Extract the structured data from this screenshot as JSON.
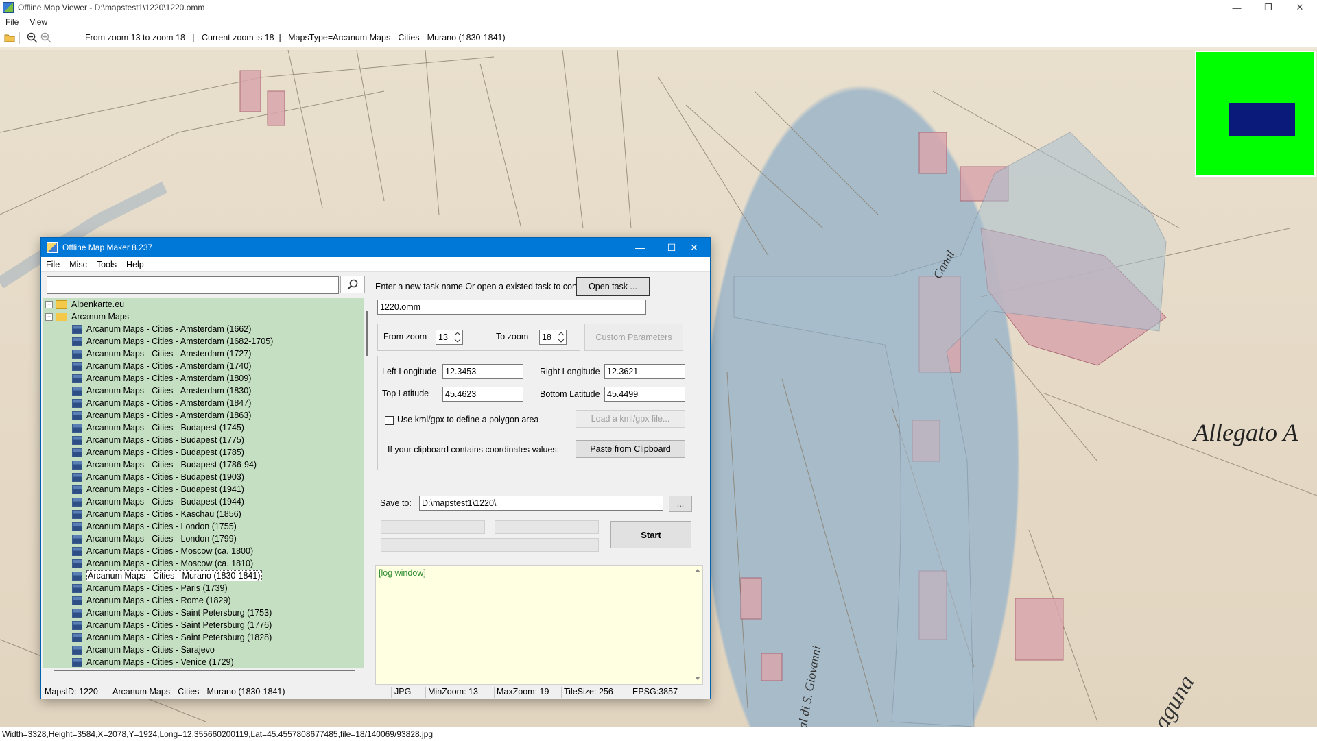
{
  "app": {
    "title": "Offline Map Viewer - D:\\mapstest1\\1220\\1220.omm",
    "menu": [
      "File",
      "View"
    ],
    "toolbar_info": "From zoom 13 to zoom 18   |   Current zoom is 18  |   MapsType=Arcanum Maps - Cities - Murano (1830-1841)",
    "icons": {
      "open": "folder-open-icon",
      "zoom_out": "zoom-out-icon",
      "zoom_in": "zoom-in-icon"
    },
    "statusbar": "Width=3328,Height=3584,X=2078,Y=1924,Long=12.355660200119,Lat=45.4557808677485,file=18/140069/93828.jpg"
  },
  "map": {
    "labels": [
      "Allegato A",
      "Canal",
      "Laguna",
      "Canal di S. Giovanni"
    ],
    "minimap_colors": {
      "background": "#00ff00",
      "viewport": "#0a1a7a"
    }
  },
  "dialog": {
    "title": "Offline Map Maker 8.237",
    "menu": [
      "File",
      "Misc",
      "Tools",
      "Help"
    ],
    "search_value": "",
    "tree": {
      "folders": [
        {
          "label": "Alpenkarte.eu",
          "expanded": false
        },
        {
          "label": "Arcanum Maps",
          "expanded": true
        }
      ],
      "items": [
        "Arcanum Maps - Cities - Amsterdam (1662)",
        "Arcanum Maps - Cities - Amsterdam (1682-1705)",
        "Arcanum Maps - Cities - Amsterdam (1727)",
        "Arcanum Maps - Cities - Amsterdam (1740)",
        "Arcanum Maps - Cities - Amsterdam (1809)",
        "Arcanum Maps - Cities - Amsterdam (1830)",
        "Arcanum Maps - Cities - Amsterdam (1847)",
        "Arcanum Maps - Cities - Amsterdam (1863)",
        "Arcanum Maps - Cities - Budapest (1745)",
        "Arcanum Maps - Cities - Budapest (1775)",
        "Arcanum Maps - Cities - Budapest (1785)",
        "Arcanum Maps - Cities - Budapest (1786-94)",
        "Arcanum Maps - Cities - Budapest (1903)",
        "Arcanum Maps - Cities - Budapest (1941)",
        "Arcanum Maps - Cities - Budapest (1944)",
        "Arcanum Maps - Cities - Kaschau (1856)",
        "Arcanum Maps - Cities - London (1755)",
        "Arcanum Maps - Cities - London (1799)",
        "Arcanum Maps - Cities - Moscow (ca. 1800)",
        "Arcanum Maps - Cities - Moscow (ca. 1810)",
        "Arcanum Maps - Cities - Murano (1830-1841)",
        "Arcanum Maps - Cities - Paris (1739)",
        "Arcanum Maps - Cities - Rome (1829)",
        "Arcanum Maps - Cities - Saint Petersburg (1753)",
        "Arcanum Maps - Cities - Saint Petersburg (1776)",
        "Arcanum Maps - Cities - Saint Petersburg (1828)",
        "Arcanum Maps - Cities - Sarajevo",
        "Arcanum Maps - Cities - Venice (1729)"
      ],
      "selected_index": 20
    },
    "task_prompt": "Enter a new task name Or open a existed task to continue:",
    "open_task_label": "Open task ...",
    "task_name": "1220.omm",
    "from_zoom_label": "From zoom",
    "from_zoom": "13",
    "to_zoom_label": "To zoom",
    "to_zoom": "18",
    "custom_params_label": "Custom Parameters",
    "left_lon_label": "Left Longitude",
    "left_lon": "12.3453",
    "right_lon_label": "Right Longitude",
    "right_lon": "12.3621",
    "top_lat_label": "Top Latitude",
    "top_lat": "45.4623",
    "bottom_lat_label": "Bottom Latitude",
    "bottom_lat": "45.4499",
    "kml_checkbox_label": "Use kml/gpx to define a polygon area",
    "kml_checked": false,
    "load_kml_label": "Load a kml/gpx file...",
    "clipboard_prompt": "If your clipboard contains coordinates values:",
    "paste_label": "Paste from Clipboard",
    "save_to_label": "Save to:",
    "save_to": "D:\\mapstest1\\1220\\",
    "browse_label": "...",
    "start_label": "Start",
    "log_text": "[log window]",
    "status": {
      "maps_id": "MapsID: 1220",
      "map_name": "Arcanum Maps - Cities - Murano (1830-1841)",
      "format": "JPG",
      "min_zoom": "MinZoom: 13",
      "max_zoom": "MaxZoom: 19",
      "tile_size": "TileSize: 256",
      "epsg": "EPSG:3857"
    }
  }
}
